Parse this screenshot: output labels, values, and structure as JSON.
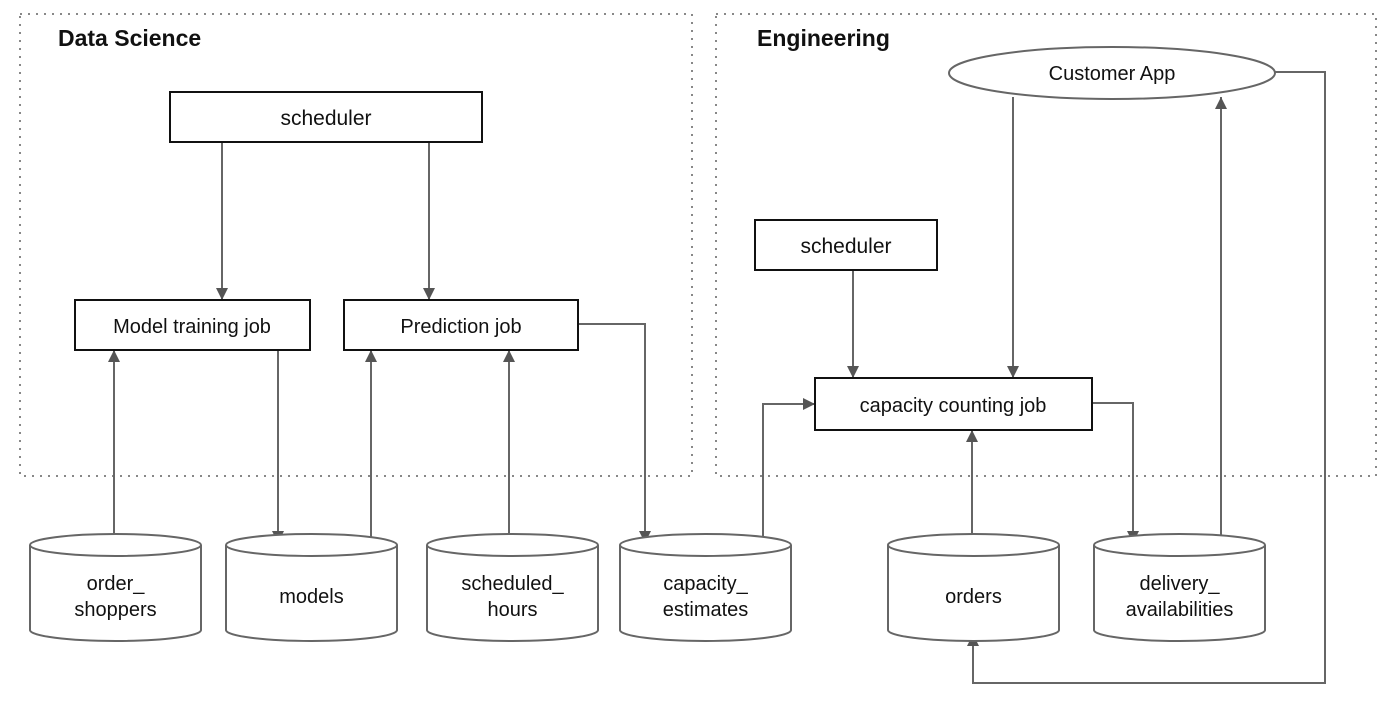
{
  "groups": {
    "data_science": "Data Science",
    "engineering": "Engineering"
  },
  "nodes": {
    "ds_scheduler": "scheduler",
    "model_training_job": "Model training job",
    "prediction_job": "Prediction job",
    "eng_scheduler": "scheduler",
    "customer_app": "Customer App",
    "capacity_counting_job": "capacity counting job"
  },
  "stores": {
    "order_shoppers": [
      "order_",
      "shoppers"
    ],
    "models": [
      "models"
    ],
    "scheduled_hours": [
      "scheduled_",
      "hours"
    ],
    "capacity_estimates": [
      "capacity_",
      "estimates"
    ],
    "orders": [
      "orders"
    ],
    "delivery_availabilities": [
      "delivery_",
      "availabilities"
    ]
  },
  "colors": {
    "edge": "#666666",
    "box_border": "#111111",
    "group_border": "#888888"
  }
}
